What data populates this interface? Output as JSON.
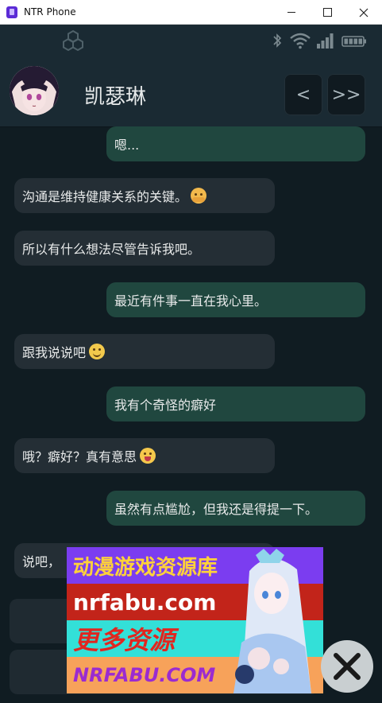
{
  "window": {
    "title": "NTR Phone"
  },
  "contact": {
    "name": "凯瑟琳"
  },
  "nav": {
    "prev": "<",
    "next": ">>"
  },
  "messages": [
    {
      "from": "me",
      "text": "嗯..."
    },
    {
      "from": "them",
      "text": "沟通是维持健康关系的关键。",
      "emoji": "hugging-face-emoji"
    },
    {
      "from": "them",
      "text": "所以有什么想法尽管告诉我吧。"
    },
    {
      "from": "me",
      "text": "最近有件事一直在我心里。"
    },
    {
      "from": "them",
      "text": "跟我说说吧",
      "emoji": "smiling-face-emoji"
    },
    {
      "from": "me",
      "text": "我有个奇怪的癖好"
    },
    {
      "from": "them",
      "text": "哦？癖好？真有意思",
      "emoji": "winking-tongue-face-emoji"
    },
    {
      "from": "me",
      "text": "虽然有点尴尬，但我还是得提一下。"
    },
    {
      "from": "them",
      "text": "说吧，"
    }
  ],
  "ad": {
    "line1": "动漫游戏资源库",
    "line2": "nrfabu.com",
    "line3": "更多资源",
    "line4": "NRFABU.COM"
  },
  "colors": {
    "phone_bg": "#101c22",
    "bubble_mine": "#20473f",
    "bubble_theirs": "#242e35"
  }
}
